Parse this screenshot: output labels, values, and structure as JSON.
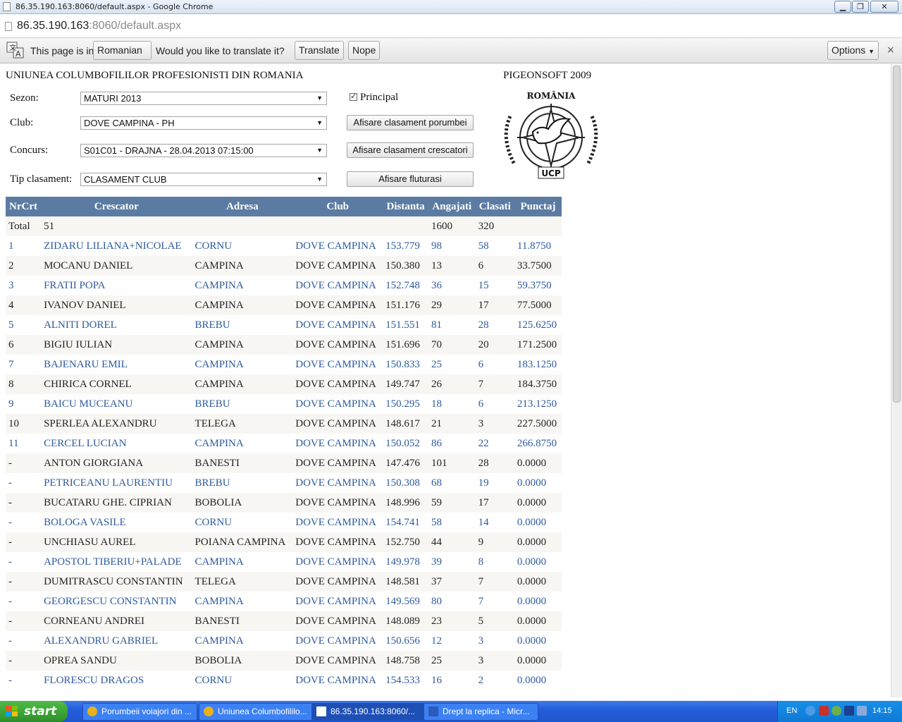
{
  "window": {
    "title": "86.35.190.163:8060/default.aspx - Google Chrome"
  },
  "address": {
    "host": "86.35.190.163",
    "rest": ":8060/default.aspx"
  },
  "translate_bar": {
    "prefix": "This page is in",
    "language": "Romanian",
    "question": "Would you like to translate it?",
    "translate_label": "Translate",
    "nope_label": "Nope",
    "options_label": "Options",
    "close": "×"
  },
  "page": {
    "org_title": "UNIUNEA COLUMBOFILILOR PROFESIONISTI DIN ROMANIA",
    "brand_title": "PIGEONSOFT 2009",
    "logo_text_top": "ROMÂNIA",
    "logo_text_bottom": "UCP",
    "form": {
      "sezon_label": "Sezon:",
      "sezon_value": "MATURI 2013",
      "principal_label": "Principal",
      "principal_checked": true,
      "club_label": "Club:",
      "club_value": "DOVE CAMPINA - PH",
      "concurs_label": "Concurs:",
      "concurs_value": "S01C01 - DRAJNA - 28.04.2013 07:15:00",
      "tip_label": "Tip clasament:",
      "tip_value": "CLASAMENT CLUB",
      "btn_porumbei": "Afisare clasament porumbei",
      "btn_crescatori": "Afisare clasament crescatori",
      "btn_fluturasi": "Afisare fluturasi"
    }
  },
  "table": {
    "headers": [
      "NrCrt",
      "Crescator",
      "Adresa",
      "Club",
      "Distanta",
      "Angajati",
      "Clasati",
      "Punctaj"
    ],
    "total": {
      "label": "Total",
      "count": "51",
      "angajati": "1600",
      "clasati": "320"
    },
    "rows": [
      [
        "1",
        "ZIDARU LILIANA+NICOLAE",
        "CORNU",
        "DOVE CAMPINA",
        "153.779",
        "98",
        "58",
        "11.8750"
      ],
      [
        "2",
        "MOCANU DANIEL",
        "CAMPINA",
        "DOVE CAMPINA",
        "150.380",
        "13",
        "6",
        "33.7500"
      ],
      [
        "3",
        "FRATII POPA",
        "CAMPINA",
        "DOVE CAMPINA",
        "152.748",
        "36",
        "15",
        "59.3750"
      ],
      [
        "4",
        "IVANOV DANIEL",
        "CAMPINA",
        "DOVE CAMPINA",
        "151.176",
        "29",
        "17",
        "77.5000"
      ],
      [
        "5",
        "ALNITI DOREL",
        "BREBU",
        "DOVE CAMPINA",
        "151.551",
        "81",
        "28",
        "125.6250"
      ],
      [
        "6",
        "BIGIU IULIAN",
        "CAMPINA",
        "DOVE CAMPINA",
        "151.696",
        "70",
        "20",
        "171.2500"
      ],
      [
        "7",
        "BAJENARU EMIL",
        "CAMPINA",
        "DOVE CAMPINA",
        "150.833",
        "25",
        "6",
        "183.1250"
      ],
      [
        "8",
        "CHIRICA CORNEL",
        "CAMPINA",
        "DOVE CAMPINA",
        "149.747",
        "26",
        "7",
        "184.3750"
      ],
      [
        "9",
        "BAICU MUCEANU",
        "BREBU",
        "DOVE CAMPINA",
        "150.295",
        "18",
        "6",
        "213.1250"
      ],
      [
        "10",
        "SPERLEA ALEXANDRU",
        "TELEGA",
        "DOVE CAMPINA",
        "148.617",
        "21",
        "3",
        "227.5000"
      ],
      [
        "11",
        "CERCEL LUCIAN",
        "CAMPINA",
        "DOVE CAMPINA",
        "150.052",
        "86",
        "22",
        "266.8750"
      ],
      [
        "-",
        "ANTON GIORGIANA",
        "BANESTI",
        "DOVE CAMPINA",
        "147.476",
        "101",
        "28",
        "0.0000"
      ],
      [
        "-",
        "PETRICEANU LAURENTIU",
        "BREBU",
        "DOVE CAMPINA",
        "150.308",
        "68",
        "19",
        "0.0000"
      ],
      [
        "-",
        "BUCATARU GHE. CIPRIAN",
        "BOBOLIA",
        "DOVE CAMPINA",
        "148.996",
        "59",
        "17",
        "0.0000"
      ],
      [
        "-",
        "BOLOGA VASILE",
        "CORNU",
        "DOVE CAMPINA",
        "154.741",
        "58",
        "14",
        "0.0000"
      ],
      [
        "-",
        "UNCHIASU AUREL",
        "POIANA CAMPINA",
        "DOVE CAMPINA",
        "152.750",
        "44",
        "9",
        "0.0000"
      ],
      [
        "-",
        "APOSTOL TIBERIU+PALADE",
        "CAMPINA",
        "DOVE CAMPINA",
        "149.978",
        "39",
        "8",
        "0.0000"
      ],
      [
        "-",
        "DUMITRASCU CONSTANTIN",
        "TELEGA",
        "DOVE CAMPINA",
        "148.581",
        "37",
        "7",
        "0.0000"
      ],
      [
        "-",
        "GEORGESCU CONSTANTIN",
        "CAMPINA",
        "DOVE CAMPINA",
        "149.569",
        "80",
        "7",
        "0.0000"
      ],
      [
        "-",
        "CORNEANU ANDREI",
        "BANESTI",
        "DOVE CAMPINA",
        "148.089",
        "23",
        "5",
        "0.0000"
      ],
      [
        "-",
        "ALEXANDRU GABRIEL",
        "CAMPINA",
        "DOVE CAMPINA",
        "150.656",
        "12",
        "3",
        "0.0000"
      ],
      [
        "-",
        "OPREA SANDU",
        "BOBOLIA",
        "DOVE CAMPINA",
        "148.758",
        "25",
        "3",
        "0.0000"
      ],
      [
        "-",
        "FLORESCU DRAGOS",
        "CORNU",
        "DOVE CAMPINA",
        "154.533",
        "16",
        "2",
        "0.0000"
      ]
    ]
  },
  "taskbar": {
    "start_label": "start",
    "items": [
      "Porumbeii voiajori din ...",
      "Uniunea Columbofililo...",
      "86.35.190.163:8060/...",
      "Drept la replica - Micr..."
    ],
    "language": "EN",
    "clock": "14:15"
  },
  "colors": {
    "table_header": "#5b7ba3",
    "link_text": "#2d5a9e",
    "row_alt": "#f7f6f3",
    "taskbar": "#245edb"
  }
}
